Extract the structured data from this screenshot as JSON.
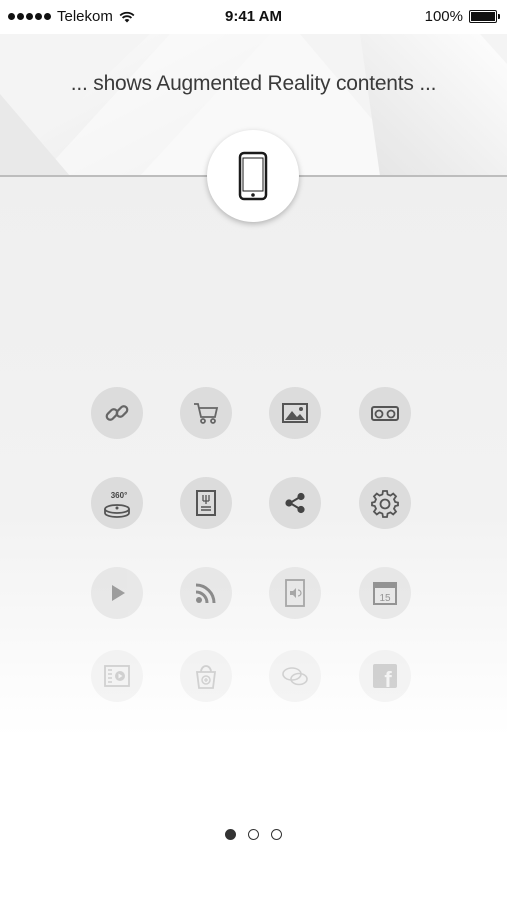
{
  "status_bar": {
    "carrier": "Telekom",
    "time": "9:41 AM",
    "battery": "100%"
  },
  "header": {
    "tagline": "... shows Augmented Reality contents ..."
  },
  "icons": [
    {
      "name": "link-icon"
    },
    {
      "name": "shopping-cart-icon"
    },
    {
      "name": "image-icon"
    },
    {
      "name": "vr-glasses-icon"
    },
    {
      "name": "360-view-icon",
      "label": "360°"
    },
    {
      "name": "menu-card-icon"
    },
    {
      "name": "share-icon"
    },
    {
      "name": "gear-icon"
    },
    {
      "name": "play-icon"
    },
    {
      "name": "rss-icon"
    },
    {
      "name": "audio-icon"
    },
    {
      "name": "calendar-icon",
      "label": "15"
    },
    {
      "name": "video-list-icon"
    },
    {
      "name": "shopping-bag-icon"
    },
    {
      "name": "chat-icon"
    },
    {
      "name": "facebook-icon",
      "label": "f"
    }
  ],
  "pager": {
    "pages": 3,
    "active": 1
  }
}
